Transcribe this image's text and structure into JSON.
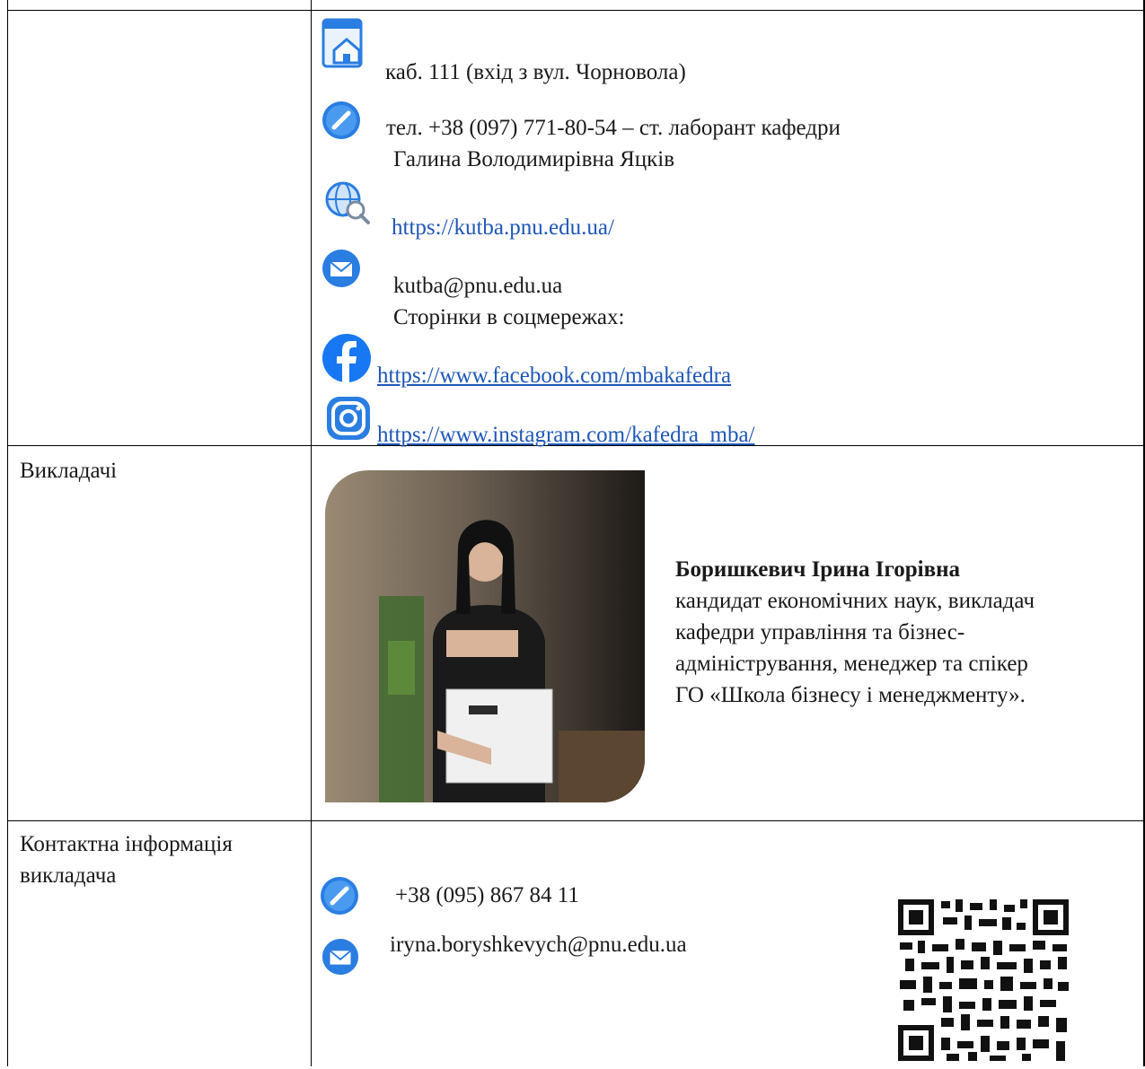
{
  "location": {
    "icon": "building-icon",
    "text": "каб. 111 (вхід з вул. Чорновола)"
  },
  "phone": {
    "icon": "phone-icon",
    "line1": "тел. +38 (097) 771-80-54 –  ст. лаборант кафедри",
    "line2": "Галина Володимирівна Яцків"
  },
  "website": {
    "icon": "globe-search-icon",
    "url": "https://kutba.pnu.edu.ua/"
  },
  "email": {
    "icon": "mail-icon",
    "address": "kutba@pnu.edu.ua"
  },
  "social": {
    "heading": "Сторінки в соцмережах:",
    "facebook": {
      "icon": "facebook-icon",
      "url": "https://www.facebook.com/mbakafedra"
    },
    "instagram": {
      "icon": "instagram-icon",
      "url": "https://www.instagram.com/kafedra_mba/"
    }
  },
  "teachers": {
    "label": "Викладачі",
    "name": "Боришкевич Ірина Ігорівна",
    "bio": [
      "кандидат економічних наук, викладач",
      "кафедри управління та бізнес-",
      "адміністрування, менеджер та спікер",
      "ГО «Школа бізнесу і менеджменту»."
    ]
  },
  "teacher_contact": {
    "label": [
      "Контактна інформація",
      "викладача"
    ],
    "phone": "+38 (095) 867 84 11",
    "email": "iryna.boryshkevych@pnu.edu.ua"
  },
  "colors": {
    "link": "#1f57b8",
    "icon_blue": "#2a7de1"
  }
}
